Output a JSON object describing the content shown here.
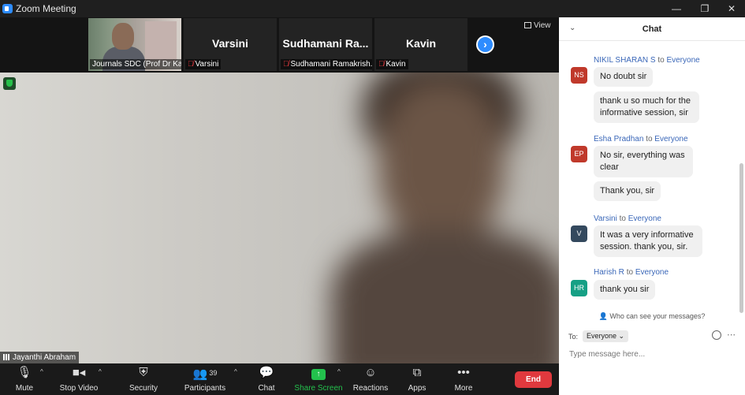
{
  "window": {
    "title": "Zoom Meeting",
    "minimize": "—",
    "restore": "❐",
    "close": "✕"
  },
  "thumbnails": [
    {
      "name": "",
      "label": "Journals SDC (Prof Dr Kar...",
      "muted": false
    },
    {
      "name": "Varsini",
      "label": "Varsini",
      "muted": true
    },
    {
      "name": "Sudhamani  Ra...",
      "label": "Sudhamani Ramakrish...",
      "muted": true
    },
    {
      "name": "Kavin",
      "label": "Kavin",
      "muted": true
    }
  ],
  "view_label": "View",
  "active_speaker": "Jayanthi Abraham",
  "toolbar": {
    "mute": "Mute",
    "stop_video": "Stop Video",
    "security": "Security",
    "participants": "Participants",
    "participant_count": "39",
    "chat": "Chat",
    "share_screen": "Share Screen",
    "reactions": "Reactions",
    "apps": "Apps",
    "more": "More",
    "end": "End"
  },
  "chat": {
    "title": "Chat",
    "messages": [
      {
        "sender": "NIKIL SHARAN S",
        "to_word": "to",
        "recipient": "Everyone",
        "initials": "NS",
        "avatar_color": "#c0392b",
        "texts": [
          "No doubt sir",
          "thank u so much for the informative session, sir"
        ]
      },
      {
        "sender": "Esha Pradhan",
        "to_word": "to",
        "recipient": "Everyone",
        "initials": "EP",
        "avatar_color": "#c0392b",
        "texts": [
          "No sir, everything was clear",
          "Thank you, sir"
        ]
      },
      {
        "sender": "Varsini",
        "to_word": "to",
        "recipient": "Everyone",
        "initials": "V",
        "avatar_color": "#34495e",
        "texts": [
          "It was a very informative session. thank you, sir."
        ]
      },
      {
        "sender": "Harish R",
        "to_word": "to",
        "recipient": "Everyone",
        "initials": "HR",
        "avatar_color": "#16a085",
        "texts": [
          "thank you sir"
        ]
      }
    ],
    "who_can_see": "Who can see your messages?",
    "to_label": "To:",
    "recipient_select": "Everyone",
    "input_placeholder": "Type message here..."
  }
}
